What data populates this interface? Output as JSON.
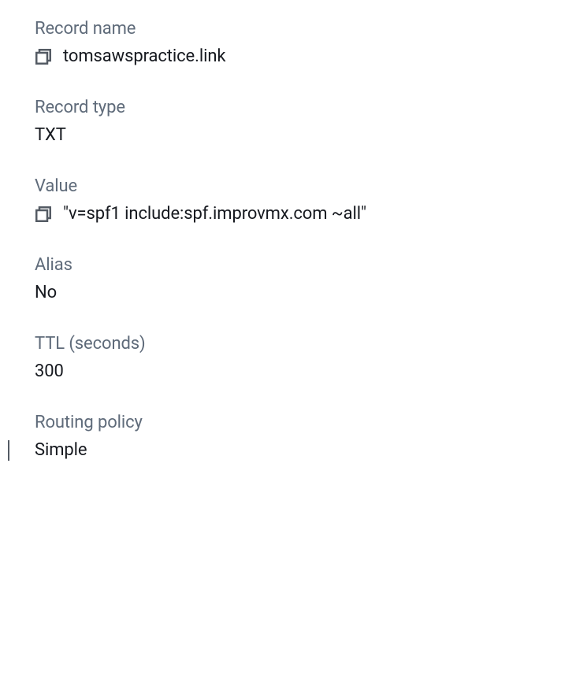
{
  "record": {
    "name_label": "Record name",
    "name_value": "tomsawspractice.link",
    "type_label": "Record type",
    "type_value": "TXT",
    "value_label": "Value",
    "value_text": "\"v=spf1 include:spf.improvmx.com ~all\"",
    "alias_label": "Alias",
    "alias_value": "No",
    "ttl_label": "TTL (seconds)",
    "ttl_value": "300",
    "routing_label": "Routing policy",
    "routing_value": "Simple"
  }
}
